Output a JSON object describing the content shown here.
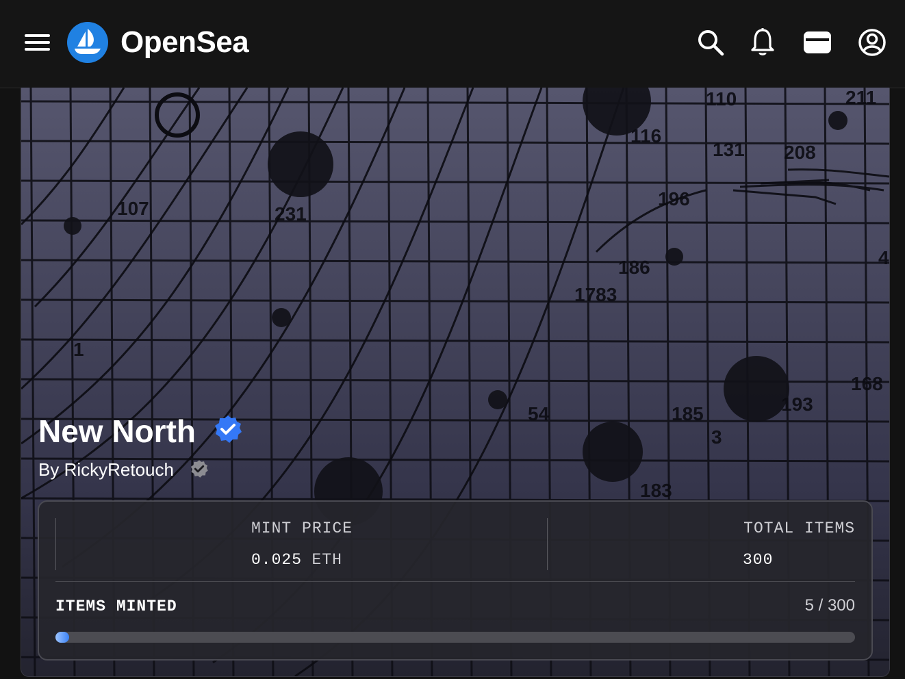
{
  "header": {
    "brand": "OpenSea",
    "menu_icon": "hamburger-menu-icon",
    "logo_icon": "opensea-ship-logo",
    "icons": [
      "search-icon",
      "bell-icon",
      "wallet-icon",
      "account-icon"
    ]
  },
  "collection": {
    "title": "New North",
    "creator": "By RickyRetouch",
    "verified_badge": "verified-badge-icon",
    "creator_badge": "creator-verified-badge-icon"
  },
  "mint": {
    "mint_price_label": "MINT PRICE",
    "mint_price_amount": "0.025",
    "mint_price_currency": "ETH",
    "total_items_label": "TOTAL ITEMS",
    "total_items_value": "300",
    "items_minted_label": "ITEMS MINTED",
    "items_minted_count": "5 / 300",
    "minted_fraction": 0.0167
  },
  "banner_chart": {
    "labels": [
      "107",
      "231",
      "110",
      "211",
      "116",
      "131",
      "208",
      "196",
      "186",
      "1783",
      "168",
      "185",
      "54",
      "183",
      "193",
      "1",
      "3",
      "4"
    ]
  },
  "colors": {
    "accent": "#2081E2",
    "verified": "#3478F6",
    "background": "#151515",
    "banner": "#2e2e3c"
  }
}
